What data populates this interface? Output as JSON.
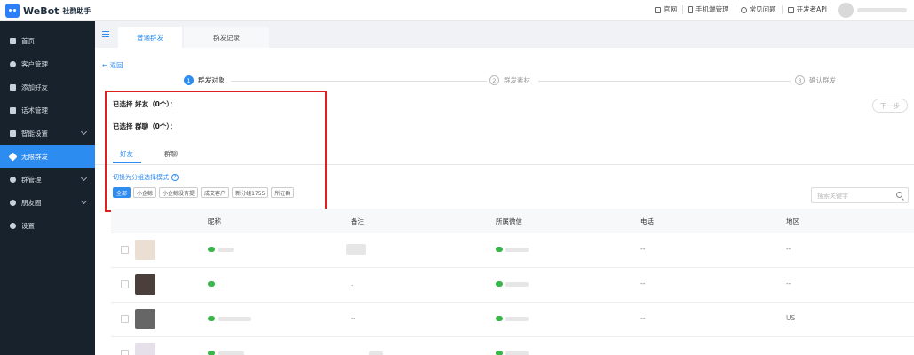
{
  "header": {
    "logo_text": "WeBot",
    "logo_sub": "社群助手",
    "links": [
      {
        "label": "官网",
        "icon": "monitor-icon"
      },
      {
        "label": "手机端管理",
        "icon": "phone-icon"
      },
      {
        "label": "常见问题",
        "icon": "question-icon"
      },
      {
        "label": "开发者API",
        "icon": "api-icon"
      }
    ]
  },
  "sidebar": {
    "items": [
      {
        "label": "首页",
        "icon": "home-icon",
        "active": false
      },
      {
        "label": "客户管理",
        "icon": "user-icon",
        "active": false
      },
      {
        "label": "添加好友",
        "icon": "add-friend-icon",
        "active": false
      },
      {
        "label": "话术管理",
        "icon": "script-icon",
        "active": false
      },
      {
        "label": "智能设置",
        "icon": "smart-icon",
        "active": false
      },
      {
        "label": "无限群发",
        "icon": "send-icon",
        "active": true
      },
      {
        "label": "群管理",
        "icon": "group-icon",
        "active": false
      },
      {
        "label": "朋友圈",
        "icon": "moments-icon",
        "active": false
      },
      {
        "label": "设置",
        "icon": "gear-icon",
        "active": false
      }
    ]
  },
  "tabs": [
    "普通群发",
    "群发记录"
  ],
  "back_label": "返回",
  "steps": [
    {
      "num": "1",
      "label": "群发对象"
    },
    {
      "num": "2",
      "label": "群发素材"
    },
    {
      "num": "3",
      "label": "确认群发"
    }
  ],
  "next_label": "下一步",
  "selected": {
    "friends": "已选择 好友（0个）：",
    "groups": "已选择 群聊（0个）："
  },
  "sub_tabs": [
    "好友",
    "群聊"
  ],
  "switch_label": "切换为分组选择模式",
  "help_glyph": "?",
  "group_tags": [
    "全部",
    "小企鲸",
    "小企鲸没有提",
    "成交客户",
    "新分组1755",
    "所在群"
  ],
  "search_placeholder": "搜索关键字",
  "table": {
    "headers": [
      "昵称",
      "备注",
      "所属微信",
      "电话",
      "地区"
    ],
    "rows": [
      {
        "remark": "",
        "phone": "--",
        "region": "--"
      },
      {
        "remark": ".",
        "phone": "--",
        "region": "--"
      },
      {
        "remark": "--",
        "phone": "--",
        "region": "US"
      },
      {
        "remark": "",
        "phone": "",
        "region": ""
      }
    ]
  },
  "colors": {
    "accent": "#2d8cf0",
    "sidebar": "#17222d",
    "highlight_box": "#e02020",
    "wechat": "#39b54a"
  }
}
